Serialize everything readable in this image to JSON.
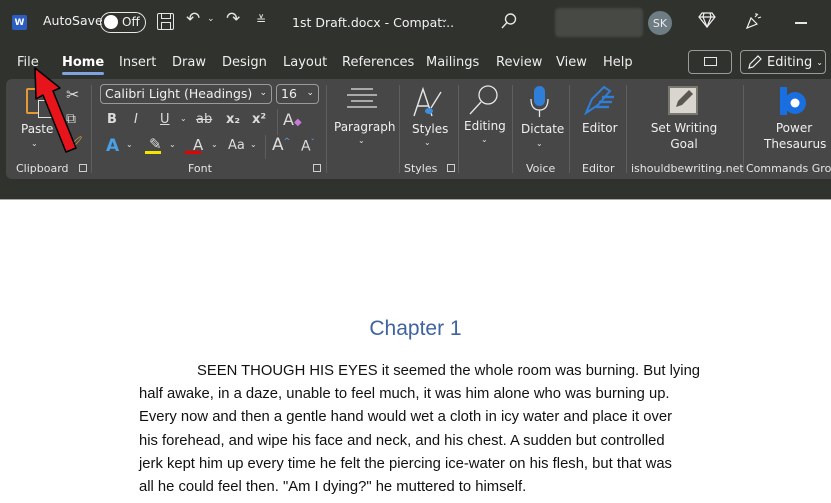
{
  "titlebar": {
    "app_icon": "word-logo-icon",
    "app_icon_letter": "W",
    "autosave_label": "AutoSave",
    "autosave_state": "Off",
    "document_title": "1st Draft.docx  -  Compat...",
    "user_initials": "SK",
    "icons": [
      "save-icon",
      "undo-icon",
      "redo-icon",
      "customize-qat-icon",
      "search-icon",
      "premium-diamond-icon",
      "celebrate-icon",
      "minimize-icon"
    ]
  },
  "tabs": [
    {
      "label": "File",
      "active": false
    },
    {
      "label": "Home",
      "active": true
    },
    {
      "label": "Insert",
      "active": false
    },
    {
      "label": "Draw",
      "active": false
    },
    {
      "label": "Design",
      "active": false
    },
    {
      "label": "Layout",
      "active": false
    },
    {
      "label": "References",
      "active": false
    },
    {
      "label": "Mailings",
      "active": false
    },
    {
      "label": "Review",
      "active": false
    },
    {
      "label": "View",
      "active": false
    },
    {
      "label": "Help",
      "active": false
    }
  ],
  "tab_right": {
    "comments_icon": "comment-icon",
    "mode_label": "Editing"
  },
  "ribbon": {
    "clipboard": {
      "paste_label": "Paste",
      "group_label": "Clipboard"
    },
    "font": {
      "font_name": "Calibri Light (Headings)",
      "font_size": "16",
      "bold": "B",
      "italic": "I",
      "underline": "U",
      "strikethrough": "ab",
      "subscript": "x₂",
      "superscript": "x²",
      "text_effects": "A",
      "font_color": "A",
      "change_case": "Aa",
      "grow_font": "A",
      "shrink_font": "A",
      "highlight_color": "#f5e600",
      "font_color_value": "#e60000",
      "group_label": "Font"
    },
    "paragraph": {
      "label": "Paragraph"
    },
    "styles": {
      "label": "Styles",
      "group_label": "Styles"
    },
    "editing": {
      "label": "Editing"
    },
    "voice": {
      "label": "Dictate",
      "group_label": "Voice"
    },
    "editor": {
      "label": "Editor",
      "group_label": "Editor"
    },
    "writing_goal": {
      "label_line1": "Set Writing",
      "label_line2": "Goal",
      "group_label": "ishouldbewriting.net"
    },
    "power_thesaurus": {
      "label_line1": "Power",
      "label_line2": "Thesaurus",
      "group_label": "Commands Grou"
    }
  },
  "document": {
    "heading": "Chapter 1",
    "heading_color": "#3f63a0",
    "lines": [
      "SEEN THOUGH HIS EYES it seemed the whole room was burning. But lying",
      "half awake, in a daze, unable to feel much, it was him alone who was burning up.",
      "Every now and then a gentle hand would wet a cloth in icy water and place it over",
      "his forehead, and wipe his face and neck, and his chest. A sudden but controlled",
      "jerk kept him up every time he felt the piercing ice-water on his flesh, but that was",
      "all he could feel then. \"Am I dying?\" he muttered to himself."
    ]
  },
  "annotation": {
    "arrow_color": "#e8141c",
    "points_to": "File"
  }
}
